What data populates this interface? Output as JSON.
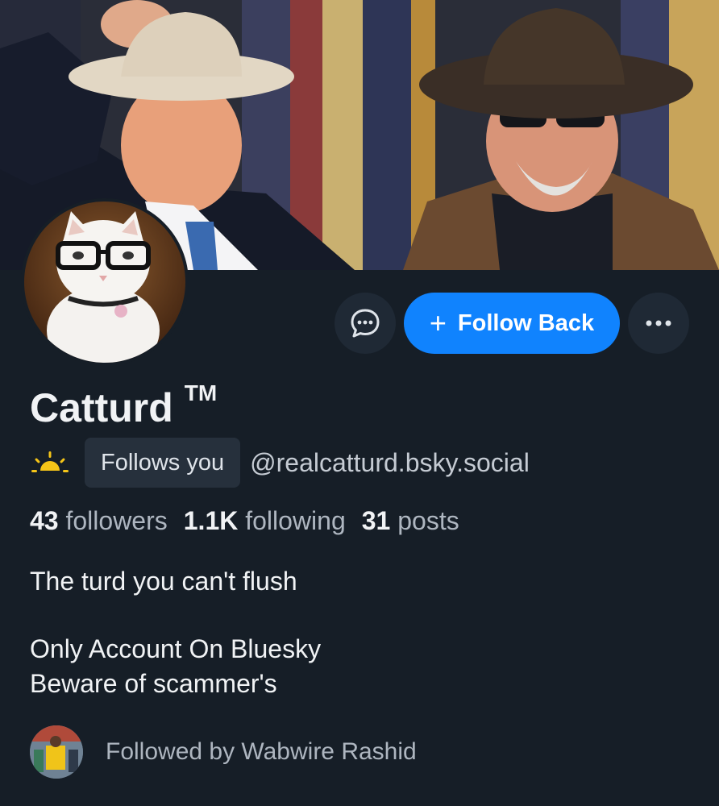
{
  "profile": {
    "display_name": "Catturd",
    "trademark": "TM",
    "follows_you_label": "Follows you",
    "handle": "@realcatturd.bsky.social",
    "badge_icon": "sunrise-icon"
  },
  "actions": {
    "message_icon": "chat-bubble-icon",
    "follow_label": "Follow Back",
    "follow_plus": "+",
    "more_icon": "ellipsis-icon"
  },
  "stats": {
    "followers_count": "43",
    "followers_label": "followers",
    "following_count": "1.1K",
    "following_label": "following",
    "posts_count": "31",
    "posts_label": "posts"
  },
  "bio": {
    "line1": "The turd you can't flush",
    "line2": "Only Account On Bluesky",
    "line3": "Beware of scammer's"
  },
  "followed_by": {
    "text": "Followed by Wabwire Rashid"
  },
  "colors": {
    "background": "#161e27",
    "accent": "#1083fe",
    "badge_bg": "#26303c",
    "sun_icon": "#f5c518"
  }
}
